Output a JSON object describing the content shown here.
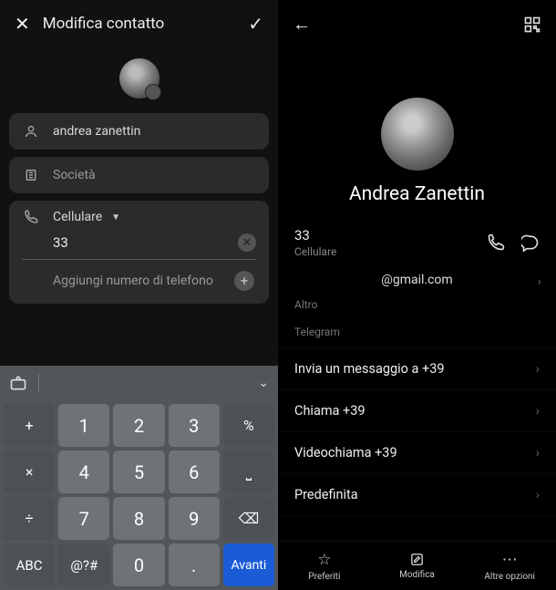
{
  "left": {
    "title": "Modifica contatto",
    "name_value": "andrea zanettin",
    "company_placeholder": "Società",
    "phone_type_label": "Cellulare",
    "phone_value": "33",
    "add_phone_label": "Aggiungi numero di telefono"
  },
  "keyboard": {
    "rows": [
      [
        "+",
        "1",
        "2",
        "3",
        "%"
      ],
      [
        "×",
        "4",
        "5",
        "6",
        "⎵"
      ],
      [
        "÷",
        "7",
        "8",
        "9",
        "⌫"
      ],
      [
        "ABC",
        "@?#",
        "0",
        ".",
        "Avanti"
      ]
    ]
  },
  "right": {
    "name": "Andrea Zanettin",
    "phone_number": "33",
    "phone_type": "Cellulare",
    "email": "@gmail.com",
    "email_sub": "Altro",
    "telegram_label": "Telegram",
    "actions": {
      "send_message": "Invia un messaggio a +39",
      "call": "Chiama +39",
      "videocall": "Videochiama +39",
      "default": "Predefinita"
    },
    "nav": {
      "favorites": "Preferiti",
      "edit": "Modifica",
      "more": "Altre opzioni"
    }
  }
}
